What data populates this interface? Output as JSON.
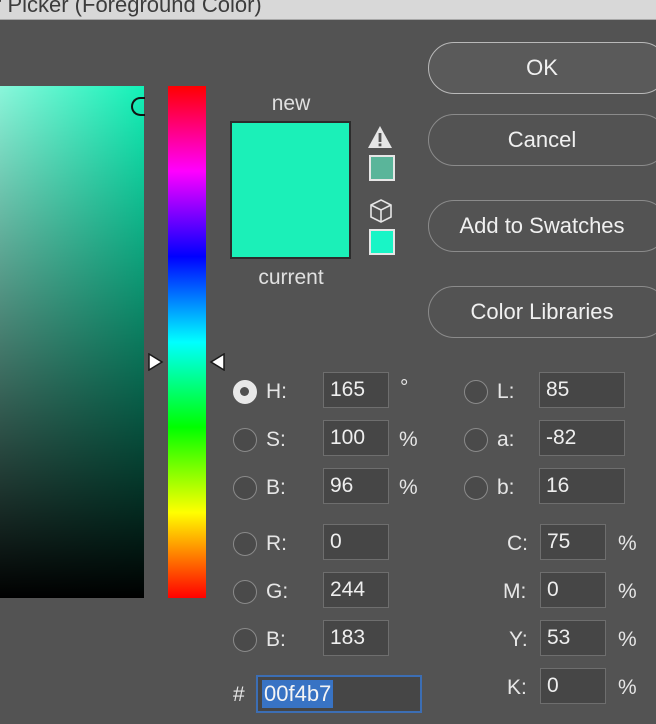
{
  "window": {
    "title": "r Picker (Foreground Color)"
  },
  "swatch": {
    "new_label": "new",
    "current_label": "current",
    "new_color": "#1bf0b8",
    "current_color": "#1bf0b8",
    "gamut_color": "#5ab59a",
    "web_color": "#19f5c6"
  },
  "buttons": {
    "ok": "OK",
    "cancel": "Cancel",
    "add_swatches": "Add to Swatches",
    "color_libraries": "Color Libraries"
  },
  "hsb": {
    "h": {
      "label": "H:",
      "value": "165",
      "unit": "°"
    },
    "s": {
      "label": "S:",
      "value": "100",
      "unit": "%"
    },
    "b": {
      "label": "B:",
      "value": "96",
      "unit": "%"
    }
  },
  "rgb": {
    "r": {
      "label": "R:",
      "value": "0"
    },
    "g": {
      "label": "G:",
      "value": "244"
    },
    "b": {
      "label": "B:",
      "value": "183"
    }
  },
  "lab": {
    "l": {
      "label": "L:",
      "value": "85"
    },
    "a": {
      "label": "a:",
      "value": "-82"
    },
    "b": {
      "label": "b:",
      "value": "16"
    }
  },
  "cmyk": {
    "c": {
      "label": "C:",
      "value": "75",
      "unit": "%"
    },
    "m": {
      "label": "M:",
      "value": "0",
      "unit": "%"
    },
    "y": {
      "label": "Y:",
      "value": "53",
      "unit": "%"
    },
    "k": {
      "label": "K:",
      "value": "0",
      "unit": "%"
    }
  },
  "hex": {
    "label": "#",
    "value": "00f4b7"
  },
  "icons": {
    "gamut_warning": "warning-triangle-icon",
    "web_safe": "cube-icon"
  }
}
